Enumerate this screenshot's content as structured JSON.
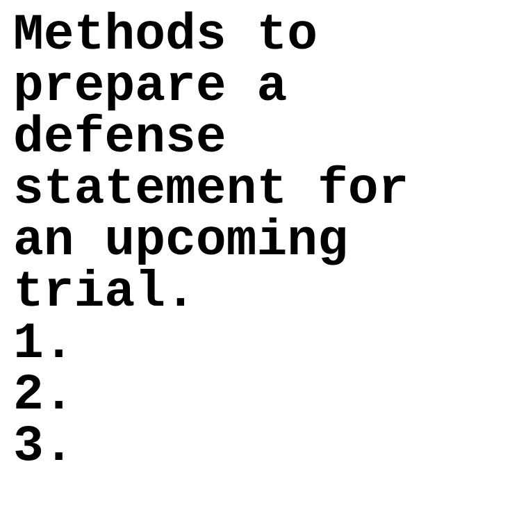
{
  "document": {
    "title_lines": [
      "Methods to",
      "prepare a",
      "defense",
      "statement for",
      "an upcoming",
      "trial."
    ],
    "list_items": [
      "1.",
      "2.",
      "3."
    ]
  },
  "colors": {
    "background": "#ffffff",
    "text": "#000000"
  }
}
